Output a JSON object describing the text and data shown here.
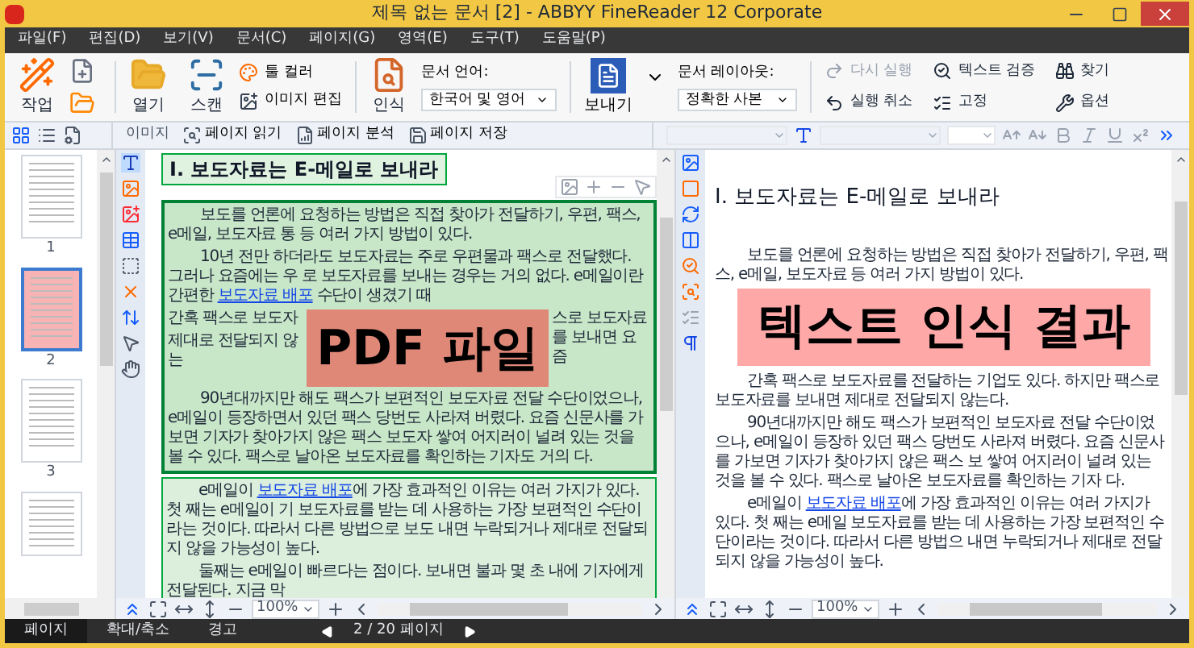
{
  "window": {
    "title": "제목 없는 문서 [2] - ABBYY FineReader 12 Corporate"
  },
  "menu": [
    "파일(F)",
    "편집(D)",
    "보기(V)",
    "문서(C)",
    "페이지(G)",
    "영역(E)",
    "도구(T)",
    "도움말(P)"
  ],
  "ribbon": {
    "task": "작업",
    "open": "열기",
    "scan": "스캔",
    "tool_color": "툴 컬러",
    "image_edit": "이미지 편집",
    "recognize": "인식",
    "language_label": "문서 언어:",
    "language": "한국어 및 영어",
    "send": "보내기",
    "layout_label": "문서 레이아웃:",
    "layout": "정확한 사본",
    "actions": [
      {
        "label": "다시 실행",
        "kind": "redo",
        "disabled": true
      },
      {
        "label": "실행 취소",
        "kind": "undo",
        "disabled": false
      },
      {
        "label": "텍스트 검증",
        "kind": "verify",
        "disabled": false
      },
      {
        "label": "고정",
        "kind": "fix",
        "disabled": false
      },
      {
        "label": "찾기",
        "kind": "find",
        "disabled": false
      },
      {
        "label": "옵션",
        "kind": "options",
        "disabled": false
      }
    ]
  },
  "image_toolbar": [
    {
      "label": "이미지",
      "kind": "title"
    },
    {
      "label": "페이지 읽기",
      "kind": "read"
    },
    {
      "label": "페이지 분석",
      "kind": "analyze"
    },
    {
      "label": "페이지 저장",
      "kind": "save"
    }
  ],
  "thumbnails": [
    {
      "label": "1",
      "selected": false
    },
    {
      "label": "2",
      "selected": true
    },
    {
      "label": "3",
      "selected": false
    }
  ],
  "pdf_page": {
    "title": "Ⅰ. 보도자료는 E-메일로 보내라",
    "paragraphs_top": [
      [
        {
          "text": "보도를 언론에 요청하는 방법은 직접 찾아가 전달하기, 우편, 팩스, e메일, 보도자료 통 등 여러 가지 방법이 있다.",
          "link": false
        }
      ],
      [
        {
          "text": "10년 전만 하더라도 보도자료는 주로 우편물과 팩스로 전달했다. 그러나 요즘에는 우 로 보도자료를 보내는 경우는 거의 없다. e메일이란 간편한 ",
          "link": false
        },
        {
          "text": "보도자료 배포",
          "link": true
        },
        {
          "text": " 수단이 생겼기 때",
          "link": false
        }
      ]
    ],
    "covered_left": [
      "간혹 팩스로 보도자",
      "제대로 전달되지 않는"
    ],
    "covered_right": "스로 보도자료를 보내면 요즘",
    "overlay": {
      "label": "PDF 파일",
      "color": "#e08878"
    },
    "paragraphs_bottom": [
      [
        {
          "text": "90년대까지만 해도 팩스가 보편적인 보도자료 전달 수단이었으나, e메일이 등장하면서 있던 팩스 당번도 사라져 버렸다. 요즘 신문사를 가보면 기자가 찾아가지 않은 팩스 보도자 쌓여 어지러이 널려 있는 것을 볼 수 있다. 팩스로 날아온 보도자료를 확인하는 기자도 거의 다.",
          "link": false
        }
      ],
      [
        {
          "text": "e메일이 ",
          "link": false
        },
        {
          "text": "보도자료 배포",
          "link": true
        },
        {
          "text": "에 가장 효과적인 이유는 여러 가지가 있다. 첫 째는 e메일이 기 보도자료를 받는 데 사용하는 가장 보편적인 수단이라는 것이다. 따라서 다른 방법으로 보도 내면 누락되거나 제대로 전달되지 않을 가능성이 높다.",
          "link": false
        }
      ],
      [
        {
          "text": "둘째는 e메일이 빠르다는 점이다. 보내면 불과 몇 초 내에 기자에게 전달된다. 지금 막",
          "link": false
        }
      ]
    ]
  },
  "text_page": {
    "title": "Ⅰ. 보도자료는 E-메일로 보내라",
    "paragraphs_top": [
      [
        {
          "text": "보도를 언론에 요청하는 방법은 직접 찾아가 전달하기, 우편, 팩스, e메일, 보도자료 등 여러 가지 방법이 있다.",
          "link": false
        }
      ]
    ],
    "overlay": {
      "label": "텍스트 인식 결과",
      "color": "#ffa8a8"
    },
    "paragraphs_bottom": [
      [
        {
          "text": "간혹 팩스로 보도자료를 전달하는 기업도 있다. 하지만 팩스로 보도자료를 보내면 제대로 전달되지 않는다.",
          "link": false
        }
      ],
      [
        {
          "text": "90년대까지만 해도 팩스가 보편적인 보도자료 전달 수단이었으나, e메일이 등장하 있던 팩스 당번도 사라져 버렸다. 요즘 신문사를 가보면 기자가 찾아가지 않은 팩스 보 쌓여 어지러이 널려 있는 것을 볼 수 있다. 팩스로 날아온 보도자료를 확인하는 기자 다.",
          "link": false
        }
      ],
      [
        {
          "text": "e메일이 ",
          "link": false
        },
        {
          "text": "보도자료 배포",
          "link": true
        },
        {
          "text": "에 가장 효과적인 이유는 여러 가지가 있다. 첫 째는 e메일 보도자료를 받는 데 사용하는 가장 보편적인 수단이라는 것이다. 따라서 다른 방법으 내면 누락되거나 제대로 전달되지 않을 가능성이 높다.",
          "link": false
        }
      ]
    ]
  },
  "zoom": [
    "100%",
    "100%"
  ],
  "status_bar": {
    "tabs": [
      {
        "label": "페이지",
        "selected": true
      },
      {
        "label": "확대/축소",
        "selected": false
      },
      {
        "label": "경고",
        "selected": false
      }
    ],
    "page": "2 / 20 페이지"
  }
}
